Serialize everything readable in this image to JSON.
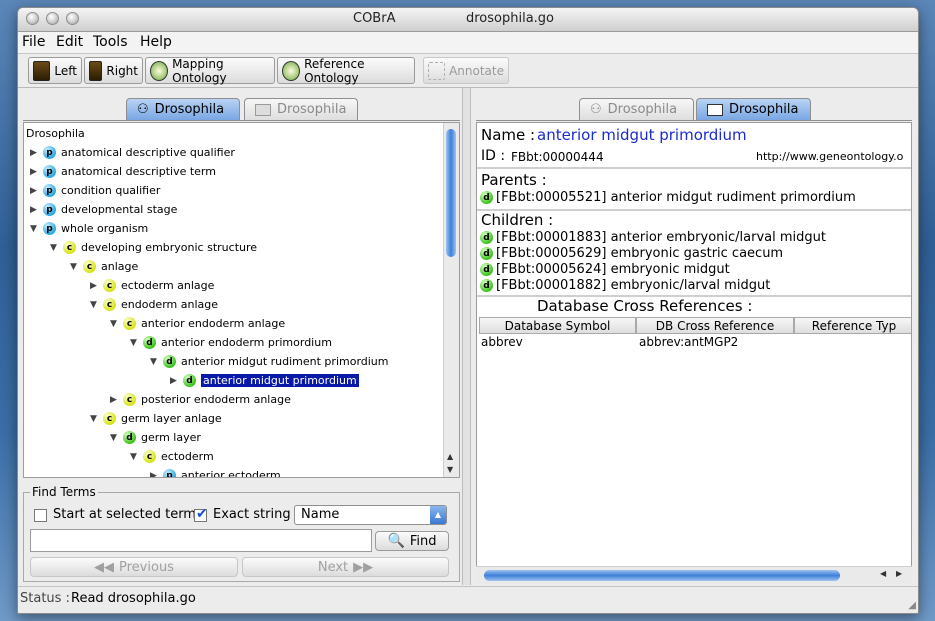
{
  "window": {
    "app_title": "COBrA",
    "file_title": "drosophila.go"
  },
  "menu": [
    "File",
    "Edit",
    "Tools",
    "Help"
  ],
  "toolbar": {
    "left": "Left",
    "right": "Right",
    "mapping": "Mapping Ontology",
    "reference": "Reference Ontology",
    "annotate": "Annotate"
  },
  "left": {
    "tabs": [
      "Drosophila",
      "Drosophila"
    ],
    "tree": [
      {
        "label": "Drosophila",
        "badge": "",
        "depth": 0,
        "toggle": "none"
      },
      {
        "label": "anatomical descriptive qualifier",
        "badge": "p",
        "depth": 0,
        "toggle": "collapsed"
      },
      {
        "label": "anatomical descriptive term",
        "badge": "p",
        "depth": 0,
        "toggle": "collapsed"
      },
      {
        "label": "condition qualifier",
        "badge": "p",
        "depth": 0,
        "toggle": "collapsed"
      },
      {
        "label": "developmental stage",
        "badge": "p",
        "depth": 0,
        "toggle": "collapsed"
      },
      {
        "label": "whole organism",
        "badge": "p",
        "depth": 0,
        "toggle": "expanded"
      },
      {
        "label": "developing embryonic structure",
        "badge": "c",
        "depth": 1,
        "toggle": "expanded"
      },
      {
        "label": "anlage",
        "badge": "c",
        "depth": 2,
        "toggle": "expanded"
      },
      {
        "label": "ectoderm anlage",
        "badge": "c",
        "depth": 3,
        "toggle": "collapsed"
      },
      {
        "label": "endoderm anlage",
        "badge": "c",
        "depth": 3,
        "toggle": "expanded"
      },
      {
        "label": "anterior endoderm anlage",
        "badge": "c",
        "depth": 4,
        "toggle": "expanded"
      },
      {
        "label": "anterior endoderm primordium",
        "badge": "d",
        "depth": 5,
        "toggle": "expanded"
      },
      {
        "label": "anterior midgut rudiment primordium",
        "badge": "d",
        "depth": 6,
        "toggle": "expanded"
      },
      {
        "label": "anterior midgut primordium",
        "badge": "d",
        "depth": 7,
        "toggle": "collapsed",
        "selected": true
      },
      {
        "label": "posterior endoderm anlage",
        "badge": "c",
        "depth": 4,
        "toggle": "collapsed"
      },
      {
        "label": "germ layer anlage",
        "badge": "c",
        "depth": 3,
        "toggle": "expanded"
      },
      {
        "label": "germ layer",
        "badge": "d",
        "depth": 4,
        "toggle": "expanded"
      },
      {
        "label": "ectoderm",
        "badge": "c",
        "depth": 5,
        "toggle": "expanded"
      },
      {
        "label": "anterior ectoderm",
        "badge": "p",
        "depth": 6,
        "toggle": "collapsed"
      }
    ],
    "find": {
      "legend": "Find Terms",
      "start_selected": "Start at selected term",
      "exact_string": "Exact string",
      "field": "Name",
      "find_btn": "Find",
      "previous": "Previous",
      "next": "Next",
      "input_value": ""
    }
  },
  "right": {
    "tabs": [
      "Drosophila",
      "Drosophila"
    ],
    "name_label": "Name :",
    "name_value": "anterior midgut primordium",
    "id_label": "ID :",
    "id_value": "FBbt:00000444",
    "url": "http://www.geneontology.o",
    "parents_label": "Parents :",
    "parents": [
      "[FBbt:00005521] anterior midgut rudiment primordium"
    ],
    "children_label": "Children :",
    "children": [
      "[FBbt:00001883] anterior embryonic/larval midgut",
      "[FBbt:00005629] embryonic gastric caecum",
      "[FBbt:00005624] embryonic midgut",
      "[FBbt:00001882] embryonic/larval midgut"
    ],
    "xref_title": "Database Cross References :",
    "xref_headers": [
      "Database Symbol",
      "DB Cross Reference",
      "Reference Typ"
    ],
    "xref_rows": [
      [
        "abbrev",
        "abbrev:antMGP2",
        ""
      ]
    ]
  },
  "status": {
    "label": "Status :",
    "text": "Read drosophila.go"
  }
}
